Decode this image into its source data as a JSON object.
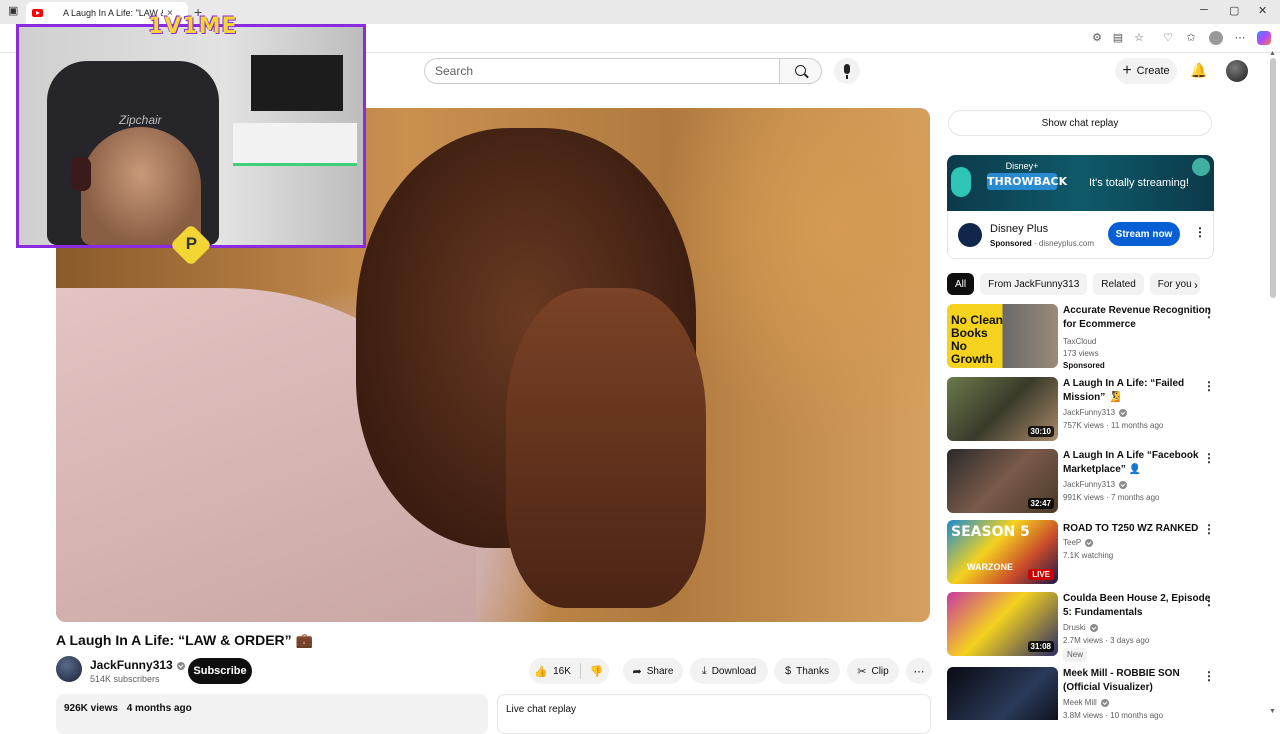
{
  "browser": {
    "tab_title": "A Laugh In A Life: \"LAW & C",
    "new_tab": "+",
    "close_tab": "×",
    "window_controls": [
      "─",
      "▢",
      "✕"
    ]
  },
  "overlay": {
    "streamer_title": "1V1ME",
    "chair_brand": "Zipchair",
    "badge_letter": "P"
  },
  "header": {
    "search_placeholder": "Search",
    "create_label": "Create"
  },
  "video": {
    "title": "A Laugh In A Life: “LAW & ORDER” 💼",
    "channel_name": "JackFunny313",
    "subscribers": "514K subscribers",
    "subscribe_label": "Subscribe",
    "likes": "16K",
    "share_label": "Share",
    "download_label": "Download",
    "thanks_label": "Thanks",
    "clip_label": "Clip",
    "views": "926K views",
    "age": "4 months ago",
    "live_chat_replay": "Live chat replay"
  },
  "sidebar": {
    "show_chat_replay": "Show chat replay",
    "ad": {
      "banner_brand": "Disney+",
      "banner_logo": "THROWBACK",
      "banner_tagline": "It's totally streaming!",
      "advertiser": "Disney Plus",
      "sponsored": "Sponsored",
      "domain": "disneyplus.com",
      "cta": "Stream now"
    },
    "chips": [
      "All",
      "From JackFunny313",
      "Related",
      "For you"
    ],
    "recommendations": [
      {
        "title": "Accurate Revenue Recognition for Ecommerce",
        "channel": "TaxCloud",
        "stats": "173 views",
        "extra": "Sponsored",
        "thumb_text": "No Clean Books No Growth",
        "duration": ""
      },
      {
        "title": "A Laugh In A Life: “Failed Mission” 🧏",
        "channel": "JackFunny313",
        "stats": "757K views · 11 months ago",
        "extra": "",
        "thumb_text": "",
        "duration": "30:10"
      },
      {
        "title": "A Laugh In A Life “Facebook Marketplace” 👤",
        "channel": "JackFunny313",
        "stats": "991K views · 7 months ago",
        "extra": "",
        "thumb_text": "",
        "duration": "32:47"
      },
      {
        "title": "ROAD TO T250 WZ RANKED",
        "channel": "TeeP",
        "stats": "7.1K watching",
        "extra": "",
        "thumb_text": "SEASON 5",
        "thumb_text2": "WARZONE",
        "duration": "LIVE"
      },
      {
        "title": "Coulda Been House 2, Episode 5: Fundamentals",
        "channel": "Druski",
        "stats": "2.7M views · 3 days ago",
        "extra": "New",
        "thumb_text": "",
        "duration": "31:08"
      },
      {
        "title": "Meek Mill - ROBBIE SON (Official Visualizer)",
        "channel": "Meek Mill",
        "stats": "3.8M views · 10 months ago",
        "extra": "",
        "thumb_text": "",
        "duration": ""
      }
    ]
  },
  "colors": {
    "overlay_border": "#8a2be2",
    "overlay_title": "#f3d534",
    "stream_button": "#065fd4",
    "live_badge": "#cc0000"
  }
}
